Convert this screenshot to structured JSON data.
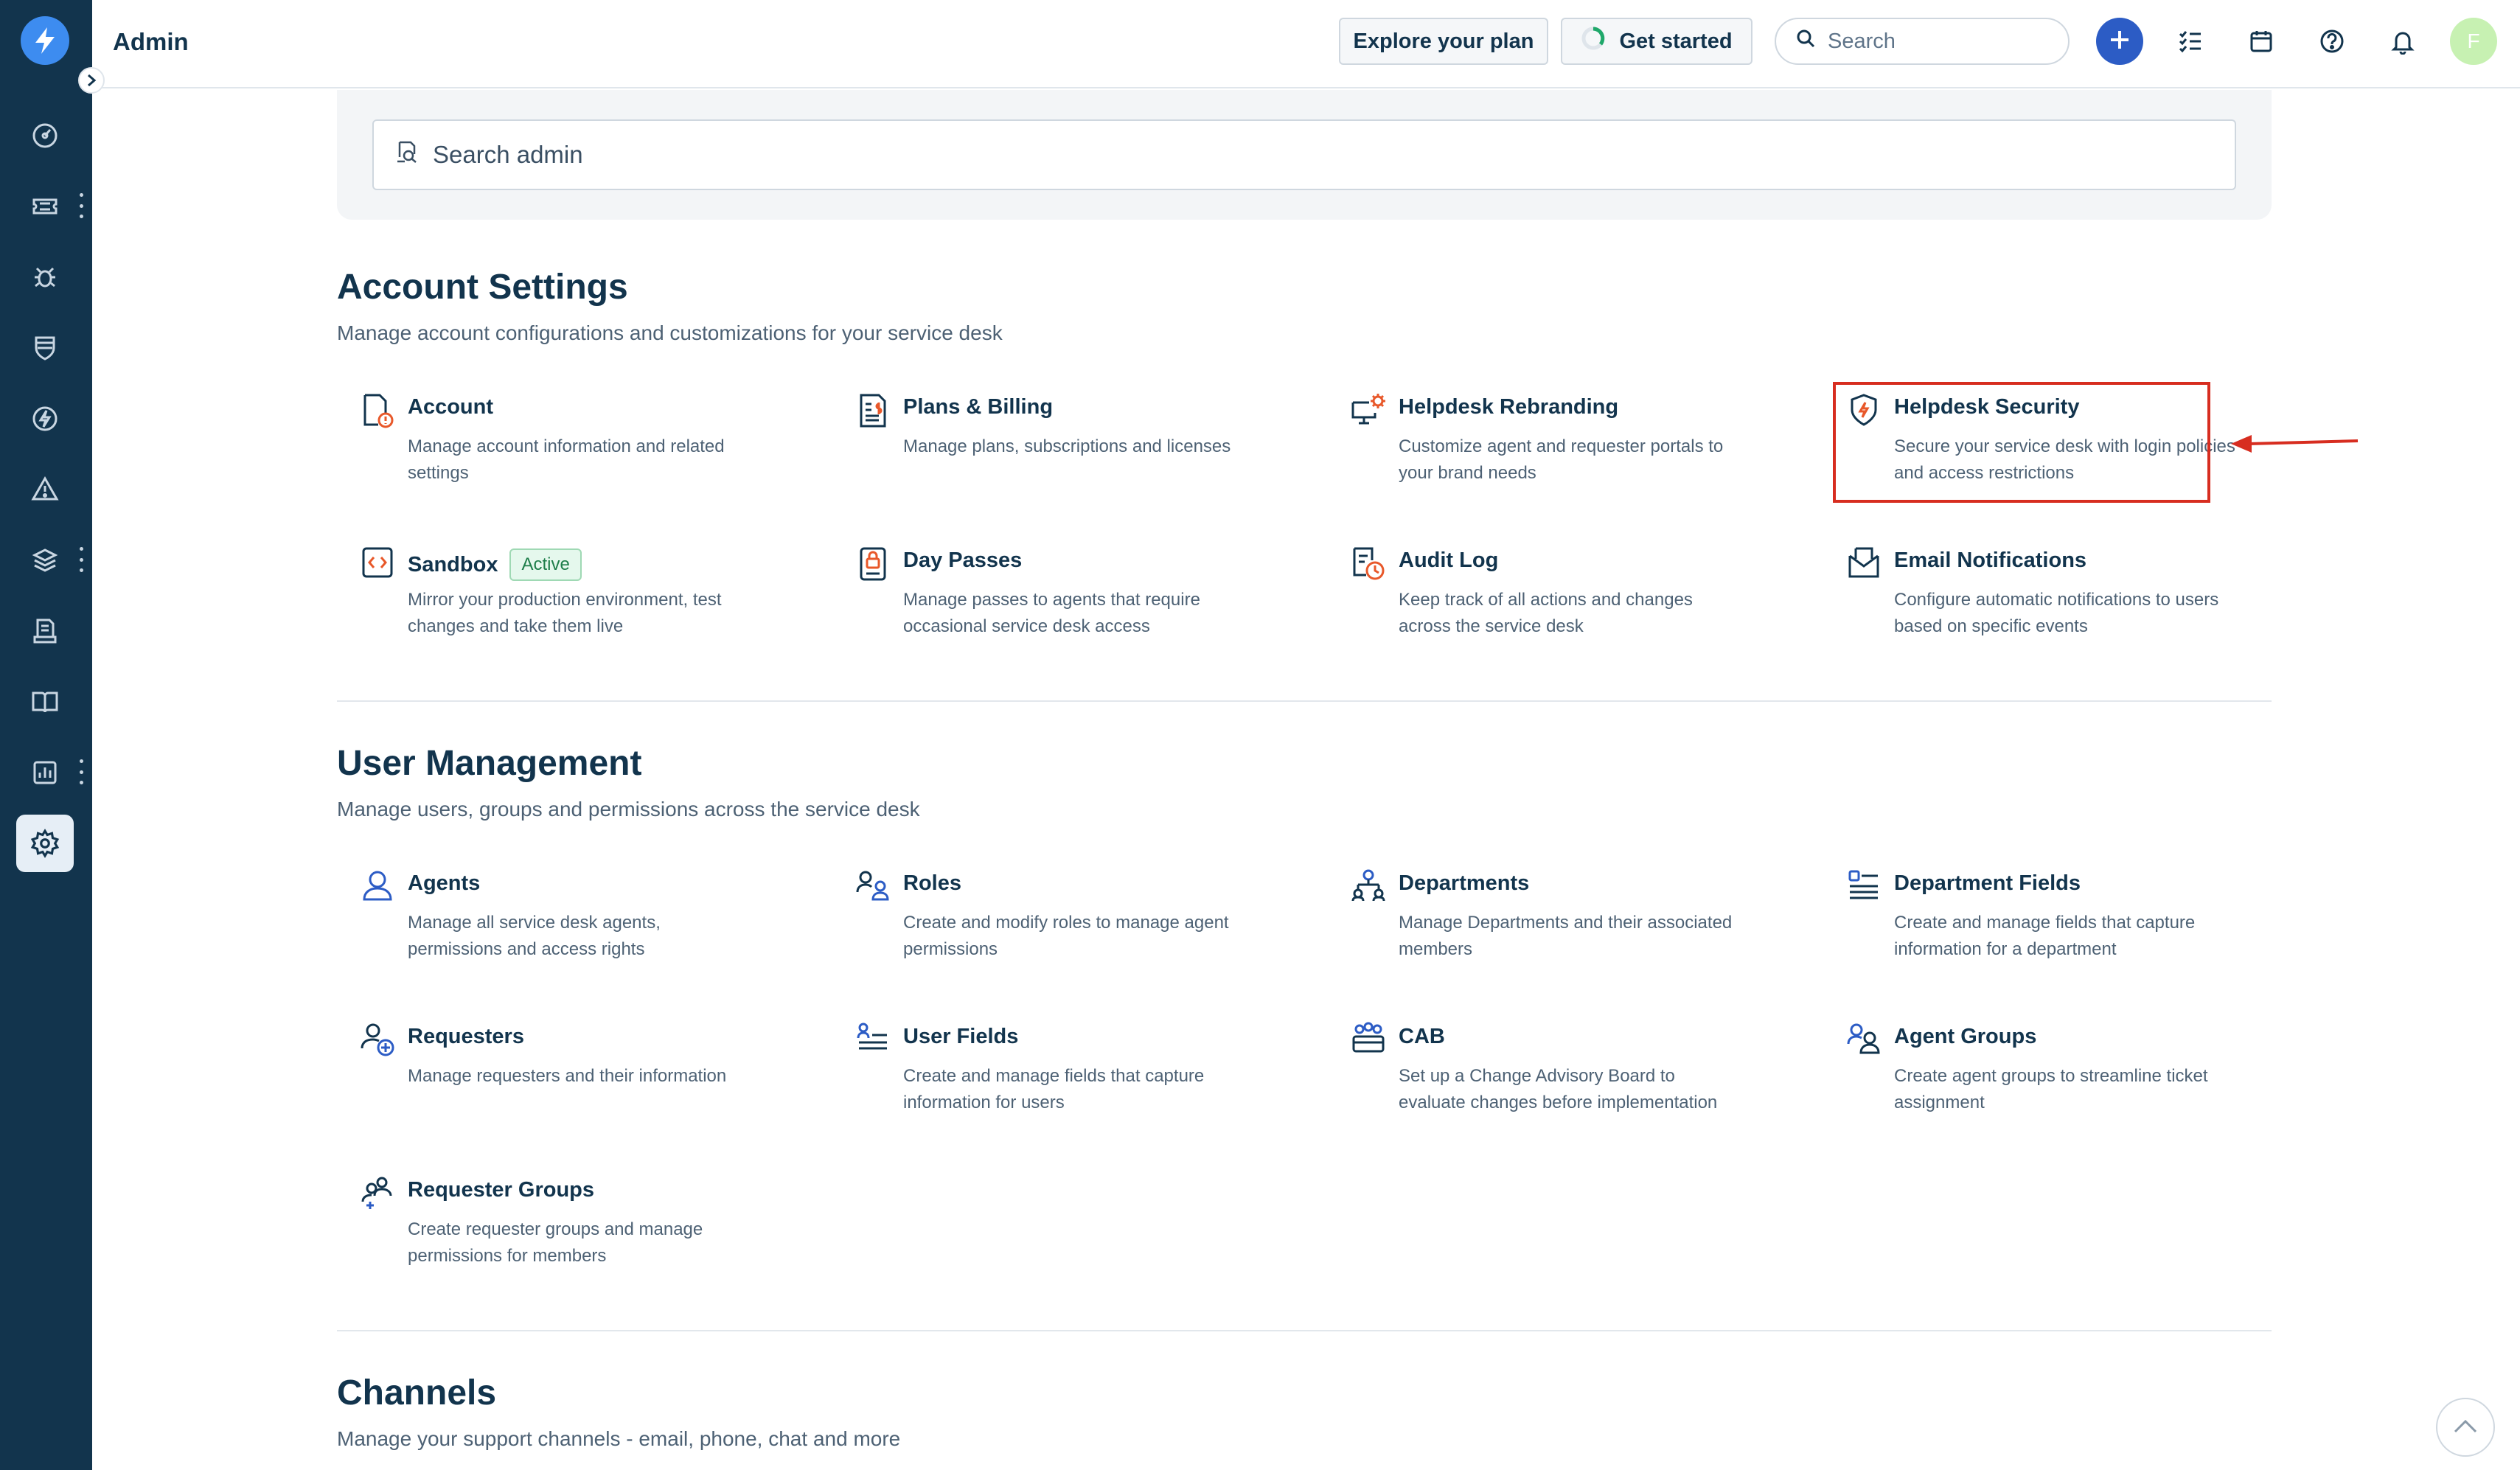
{
  "header": {
    "title": "Admin",
    "explore_label": "Explore your plan",
    "get_started_label": "Get started",
    "search_placeholder": "Search",
    "avatar_initial": "F"
  },
  "sidebar": {
    "items": [
      {
        "icon": "dashboard-icon"
      },
      {
        "icon": "tickets-icon"
      },
      {
        "icon": "problems-icon"
      },
      {
        "icon": "changes-icon"
      },
      {
        "icon": "releases-icon"
      },
      {
        "icon": "alerts-icon"
      },
      {
        "icon": "assets-icon"
      },
      {
        "icon": "solutions-icon"
      },
      {
        "icon": "knowledge-base-icon"
      },
      {
        "icon": "analytics-icon"
      },
      {
        "icon": "admin-settings-icon"
      }
    ]
  },
  "admin_search": {
    "placeholder": "Search admin"
  },
  "sections": {
    "account": {
      "title": "Account Settings",
      "subtitle": "Manage account configurations and customizations for your service desk",
      "tiles": [
        {
          "title": "Account",
          "desc": "Manage account information and related settings"
        },
        {
          "title": "Plans & Billing",
          "desc": "Manage plans, subscriptions and licenses"
        },
        {
          "title": "Helpdesk Rebranding",
          "desc": "Customize agent and requester portals to your brand needs"
        },
        {
          "title": "Helpdesk Security",
          "desc": "Secure your service desk with login policies and access restrictions"
        },
        {
          "title": "Sandbox",
          "badge": "Active",
          "desc": "Mirror your production environment, test changes and take them live"
        },
        {
          "title": "Day Passes",
          "desc": "Manage passes to agents that require occasional service desk access"
        },
        {
          "title": "Audit Log",
          "desc": "Keep track of all actions and changes across the service desk"
        },
        {
          "title": "Email Notifications",
          "desc": "Configure automatic notifications to users based on specific events"
        }
      ]
    },
    "users": {
      "title": "User Management",
      "subtitle": "Manage users, groups and permissions across the service desk",
      "tiles": [
        {
          "title": "Agents",
          "desc": "Manage all service desk agents, permissions and access rights"
        },
        {
          "title": "Roles",
          "desc": "Create and modify roles to manage agent permissions"
        },
        {
          "title": "Departments",
          "desc": "Manage Departments and their associated members"
        },
        {
          "title": "Department Fields",
          "desc": "Create and manage fields that capture information for a department"
        },
        {
          "title": "Requesters",
          "desc": "Manage requesters and their information"
        },
        {
          "title": "User Fields",
          "desc": "Create and manage fields that capture information for users"
        },
        {
          "title": "CAB",
          "desc": "Set up a Change Advisory Board to evaluate changes before implementation"
        },
        {
          "title": "Agent Groups",
          "desc": "Create agent groups to streamline ticket assignment"
        },
        {
          "title": "Requester Groups",
          "desc": "Create requester groups and manage permissions for members"
        }
      ]
    },
    "channels": {
      "title": "Channels",
      "subtitle": "Manage your support channels - email, phone, chat and more"
    }
  },
  "colors": {
    "sidebar_bg": "#12344d",
    "accent_blue": "#2c5cc5",
    "icon_orange": "#e8582a",
    "highlight_red": "#d72d20"
  }
}
